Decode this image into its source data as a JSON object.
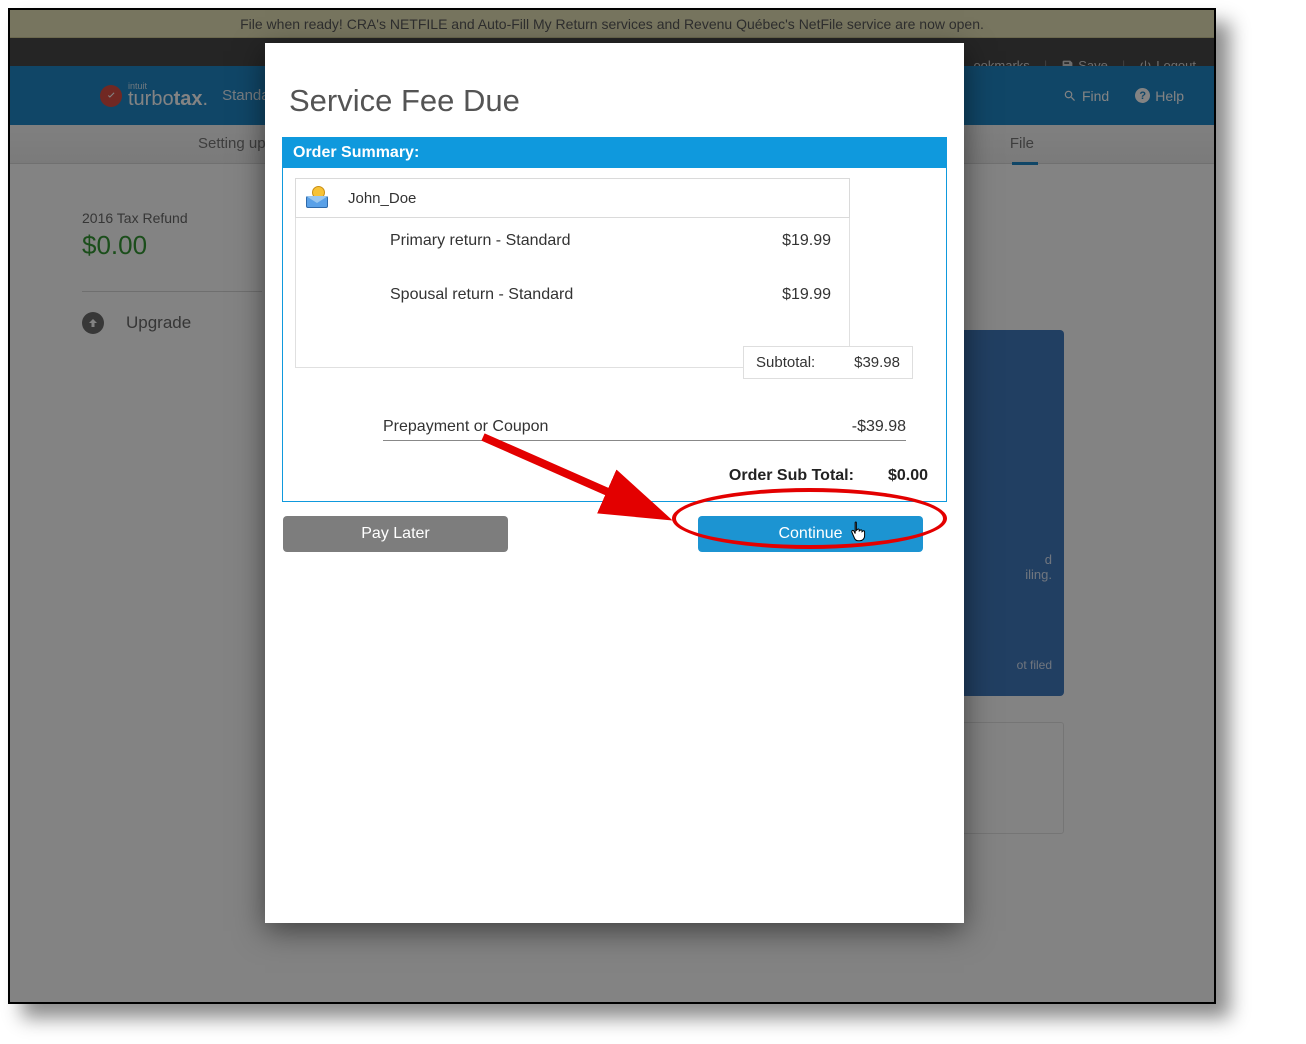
{
  "banner": "File when ready! CRA's NETFILE and Auto-Fill My Return services and Revenu Québec's NetFile service are now open.",
  "top_right": {
    "bookmarks": "ookmarks",
    "save": "Save",
    "logout": "Logout"
  },
  "logo": {
    "brand_small": "intuit",
    "brand1": "turbo",
    "brand2": "tax",
    "edition": "Standa"
  },
  "header_right": {
    "find": "Find",
    "help": "Help"
  },
  "nav": {
    "left": "Setting up",
    "right": "File"
  },
  "refund": {
    "label": "2016 Tax Refund",
    "amount": "$0.00"
  },
  "upgrade": "Upgrade",
  "side_panel": {
    "line1": "d",
    "line2": "iling.",
    "status": "ot filed"
  },
  "modal": {
    "title": "Service Fee Due",
    "order_summary_header": "Order Summary:",
    "user_name": "John_Doe",
    "items": [
      {
        "desc": "Primary return - Standard",
        "price": "$19.99"
      },
      {
        "desc": "Spousal return - Standard",
        "price": "$19.99"
      }
    ],
    "subtotal_label": "Subtotal:",
    "subtotal_value": "$39.98",
    "coupon_label": "Prepayment or Coupon",
    "coupon_value": "-$39.98",
    "order_total_label": "Order Sub Total:",
    "order_total_value": "$0.00",
    "pay_later": "Pay Later",
    "continue": "Continue"
  }
}
